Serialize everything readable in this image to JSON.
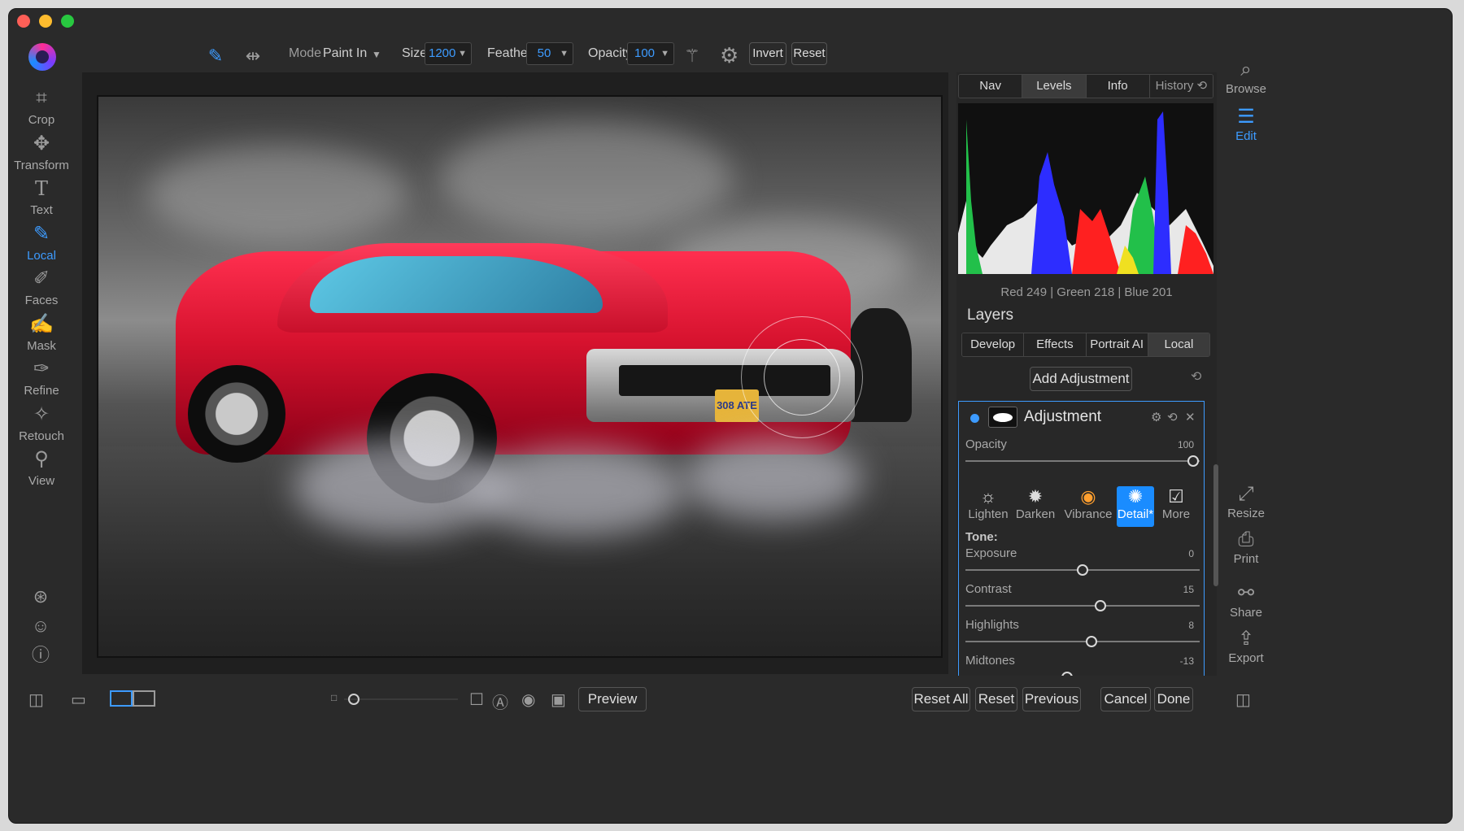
{
  "toolbar": {
    "mode_label": "Mode",
    "mode_value": "Paint In",
    "size_label": "Size",
    "size_value": "1200",
    "feather_label": "Feather",
    "feather_value": "50",
    "opacity_label": "Opacity",
    "opacity_value": "100",
    "invert_label": "Invert",
    "reset_label": "Reset"
  },
  "left_tools": [
    {
      "label": "Crop",
      "icon": "crop-icon"
    },
    {
      "label": "Transform",
      "icon": "move-icon"
    },
    {
      "label": "Text",
      "icon": "text-icon"
    },
    {
      "label": "Local",
      "icon": "brush-icon",
      "active": true
    },
    {
      "label": "Faces",
      "icon": "faces-icon"
    },
    {
      "label": "Mask",
      "icon": "mask-icon"
    },
    {
      "label": "Refine",
      "icon": "refine-icon"
    },
    {
      "label": "Retouch",
      "icon": "retouch-icon"
    },
    {
      "label": "View",
      "icon": "view-icon"
    }
  ],
  "panel": {
    "tabs": [
      "Nav",
      "Levels",
      "Info",
      "History ⟲"
    ],
    "active_tab": "Levels",
    "rgb_readout": "Red 249 | Green 218 | Blue 201",
    "layers_title": "Layers",
    "layer_tabs": [
      "Develop",
      "Effects",
      "Portrait AI",
      "Local"
    ],
    "active_layer_tab": "Local",
    "add_adjustment": "Add Adjustment",
    "adjustment": {
      "title": "Adjustment",
      "opacity_label": "Opacity",
      "opacity_value": "100",
      "filters": [
        {
          "label": "Lighten",
          "icon": "lighten-icon"
        },
        {
          "label": "Darken",
          "icon": "darken-icon"
        },
        {
          "label": "Vibrance",
          "icon": "vibrance-icon"
        },
        {
          "label": "Detail*",
          "icon": "detail-icon",
          "active": true
        },
        {
          "label": "More",
          "icon": "more-icon"
        }
      ],
      "tone_title": "Tone:",
      "sliders": [
        {
          "label": "Exposure",
          "value": "0",
          "position": 0.5
        },
        {
          "label": "Contrast",
          "value": "15",
          "position": 0.575
        },
        {
          "label": "Highlights",
          "value": "8",
          "position": 0.54
        },
        {
          "label": "Midtones",
          "value": "-13",
          "position": 0.435
        }
      ]
    }
  },
  "right_tools": [
    {
      "label": "Browse",
      "icon": "browse-icon"
    },
    {
      "label": "Edit",
      "icon": "edit-sliders-icon",
      "active": true
    },
    {
      "label": "Resize",
      "icon": "resize-icon"
    },
    {
      "label": "Print",
      "icon": "print-icon"
    },
    {
      "label": "Share",
      "icon": "share-icon"
    },
    {
      "label": "Export",
      "icon": "export-icon"
    }
  ],
  "bottom": {
    "preview": "Preview",
    "reset_all": "Reset All",
    "reset": "Reset",
    "previous": "Previous",
    "cancel": "Cancel",
    "done": "Done"
  },
  "photo": {
    "plate_text": "308 ATE"
  },
  "colors": {
    "accent": "#3d9bff",
    "background": "#2a2a2a"
  }
}
